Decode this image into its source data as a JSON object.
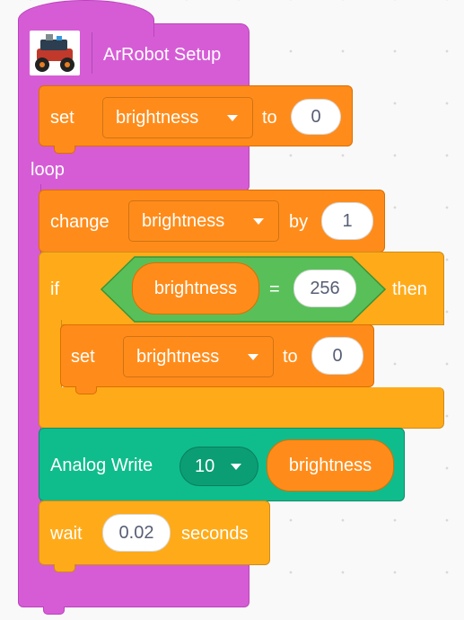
{
  "hat": {
    "title": "ArRobot Setup",
    "icon": "robot-car-icon"
  },
  "setup_set": {
    "label": "set",
    "variable": "brightness",
    "to_label": "to",
    "value": "0"
  },
  "loop_label": "loop",
  "change": {
    "label": "change",
    "variable": "brightness",
    "by_label": "by",
    "value": "1"
  },
  "if_block": {
    "if_label": "if",
    "reporter": "brightness",
    "operator": "=",
    "compare_value": "256",
    "then_label": "then",
    "inner_set": {
      "label": "set",
      "variable": "brightness",
      "to_label": "to",
      "value": "0"
    }
  },
  "analog": {
    "label": "Analog Write",
    "pin": "10",
    "reporter": "brightness"
  },
  "wait": {
    "label": "wait",
    "value": "0.02",
    "unit_label": "seconds"
  },
  "colors": {
    "events": "#d65cd6",
    "variables": "#ff8c1a",
    "control": "#ffab19",
    "operators": "#59c059",
    "extension": "#0fbd8c",
    "background": "#f9f9f9"
  }
}
